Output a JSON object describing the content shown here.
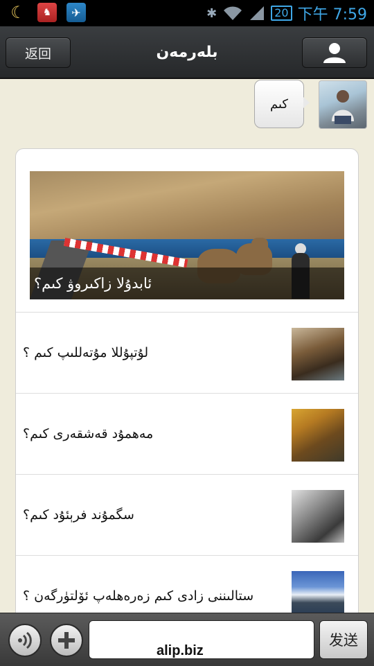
{
  "status_bar": {
    "battery": "20",
    "time": "下午 7:59"
  },
  "header": {
    "back_label": "返回",
    "title": "بلەرمەن"
  },
  "message": {
    "text": "كىم"
  },
  "news": {
    "hero_caption": "ئابدۇلا زاكىروۋ كىم؟",
    "items": [
      {
        "title": "لۇتپۇللا مۇتەللىپ  كىم ؟"
      },
      {
        "title": "مەھمۇد قەشقەرى كىم؟"
      },
      {
        "title": "سگمۇند فرېئۇد كىم؟"
      },
      {
        "title": "ستالىننى زادى كىم زەرەھلەپ ئۆلتۈرگەن ؟"
      }
    ]
  },
  "bottom_bar": {
    "send_label": "发送",
    "input_value": ""
  },
  "watermark": "alip.biz"
}
